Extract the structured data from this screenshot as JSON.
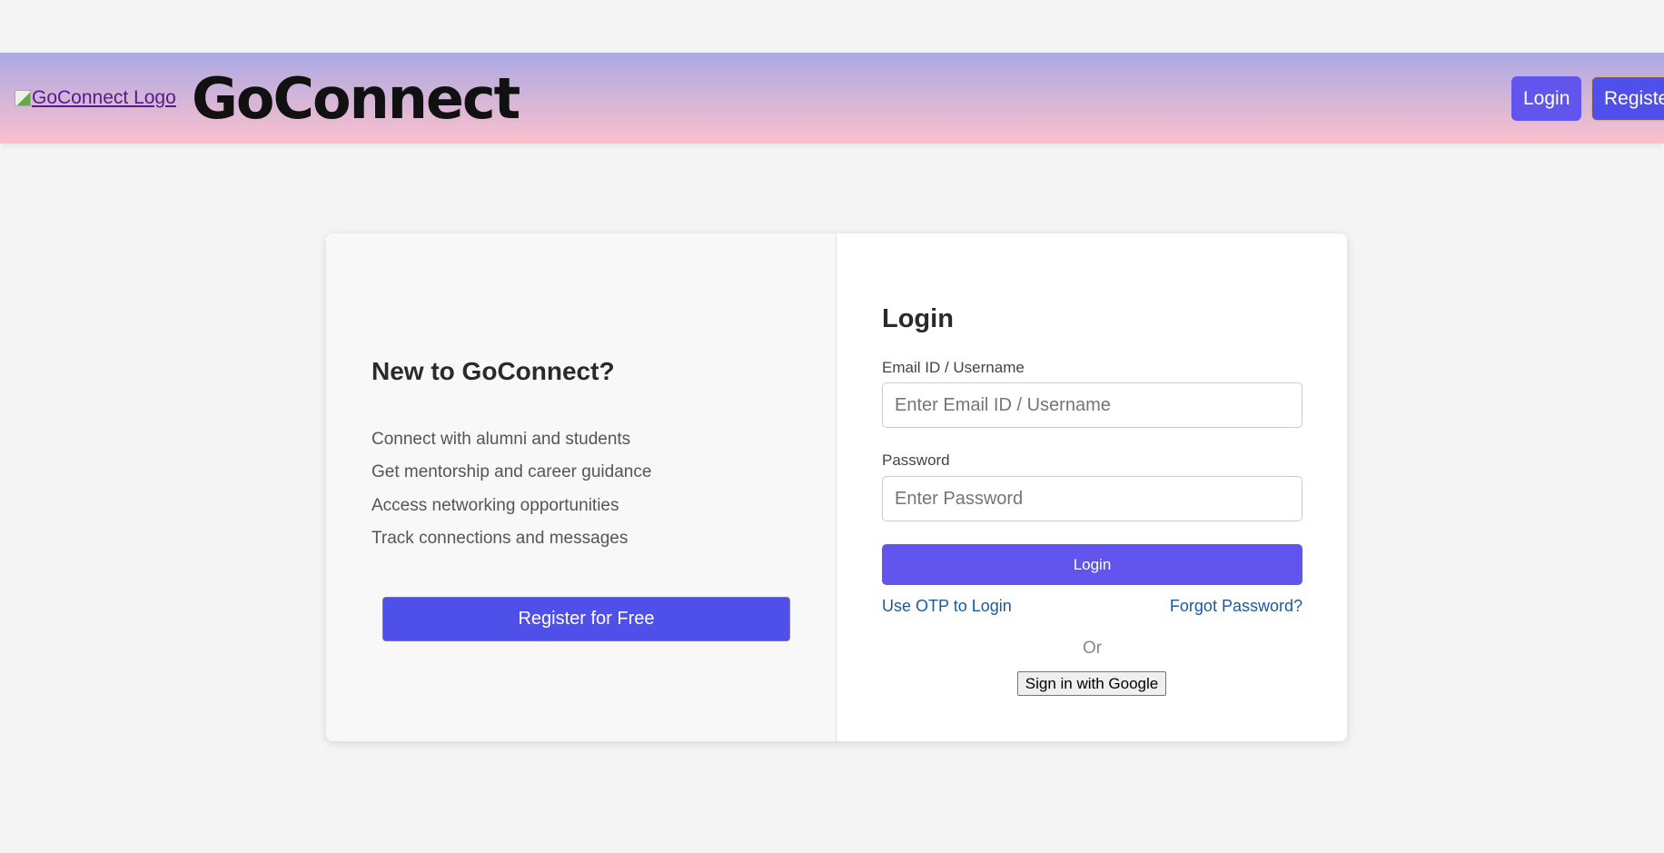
{
  "header": {
    "logo_alt": "GoConnect Logo",
    "title": "GoConnect",
    "login": "Login",
    "register": "Register"
  },
  "promo": {
    "heading": "New to GoConnect?",
    "features": [
      "Connect with alumni and students",
      "Get mentorship and career guidance",
      "Access networking opportunities",
      "Track connections and messages"
    ],
    "register_button": "Register for Free"
  },
  "login": {
    "heading": "Login",
    "email_label": "Email ID / Username",
    "email_placeholder": "Enter Email ID / Username",
    "password_label": "Password",
    "password_placeholder": "Enter Password",
    "submit": "Login",
    "otp_link": "Use OTP to Login",
    "forgot_link": "Forgot Password?",
    "or": "Or",
    "google_button": "Sign in with Google"
  }
}
